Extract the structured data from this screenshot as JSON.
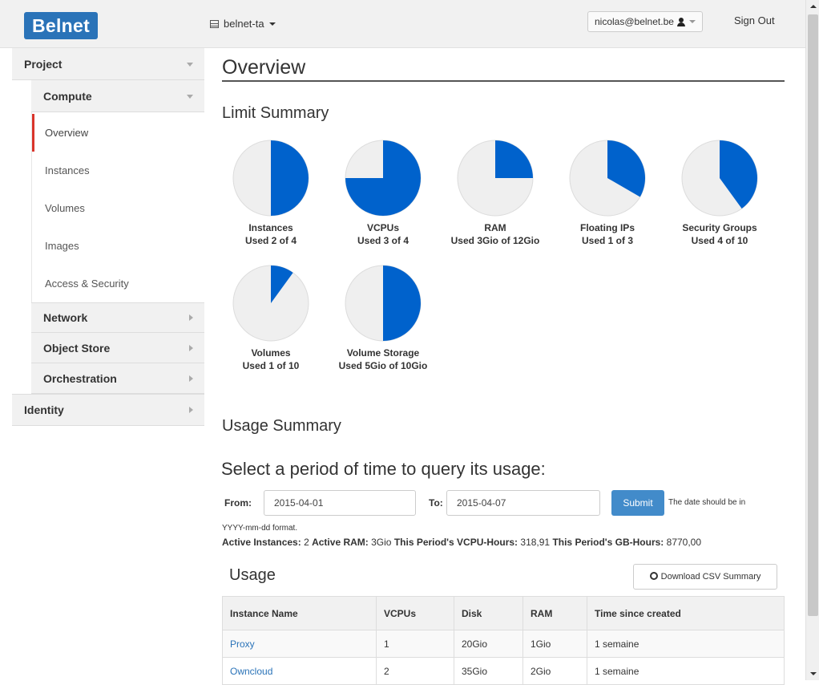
{
  "header": {
    "logo": "Belnet",
    "project": "belnet-ta",
    "user": "nicolas@belnet.be",
    "signout": "Sign Out"
  },
  "sidebar": {
    "project": "Project",
    "compute": "Compute",
    "items": [
      "Overview",
      "Instances",
      "Volumes",
      "Images",
      "Access & Security"
    ],
    "network": "Network",
    "object_store": "Object Store",
    "orchestration": "Orchestration",
    "identity": "Identity"
  },
  "page": {
    "title": "Overview",
    "limit_summary": "Limit Summary",
    "usage_summary": "Usage Summary",
    "period_title": "Select a period of time to query its usage:"
  },
  "limits": [
    {
      "name": "Instances",
      "text": "Used 2 of 4",
      "used": 2,
      "total": 4
    },
    {
      "name": "VCPUs",
      "text": "Used 3 of 4",
      "used": 3,
      "total": 4
    },
    {
      "name": "RAM",
      "text": "Used 3Gio of 12Gio",
      "used": 3,
      "total": 12
    },
    {
      "name": "Floating IPs",
      "text": "Used 1 of 3",
      "used": 1,
      "total": 3
    },
    {
      "name": "Security Groups",
      "text": "Used 4 of 10",
      "used": 4,
      "total": 10
    },
    {
      "name": "Volumes",
      "text": "Used 1 of 10",
      "used": 1,
      "total": 10
    },
    {
      "name": "Volume Storage",
      "text": "Used 5Gio of 10Gio",
      "used": 5,
      "total": 10
    }
  ],
  "form": {
    "from_label": "From:",
    "from_value": "2015-04-01",
    "to_label": "To:",
    "to_value": "2015-04-07",
    "submit": "Submit",
    "hint": "The date should be in",
    "hint2": "YYYY-mm-dd format."
  },
  "summary": {
    "active_instances_label": "Active Instances:",
    "active_instances": "2",
    "active_ram_label": "Active RAM:",
    "active_ram": "3Gio",
    "vcpu_hours_label": "This Period's VCPU-Hours:",
    "vcpu_hours": "318,91",
    "gb_hours_label": "This Period's GB-Hours:",
    "gb_hours": "8770,00"
  },
  "usage": {
    "title": "Usage",
    "csv_button": "Download CSV Summary",
    "columns": [
      "Instance Name",
      "VCPUs",
      "Disk",
      "RAM",
      "Time since created"
    ],
    "rows": [
      [
        "Proxy",
        "1",
        "20Gio",
        "1Gio",
        "1 semaine"
      ],
      [
        "Owncloud",
        "2",
        "35Gio",
        "2Gio",
        "1 semaine"
      ]
    ]
  },
  "colors": {
    "accent": "#0062cc",
    "pie_bg": "#efefef",
    "brand": "#2a73b8",
    "active_marker": "#d9342b"
  }
}
